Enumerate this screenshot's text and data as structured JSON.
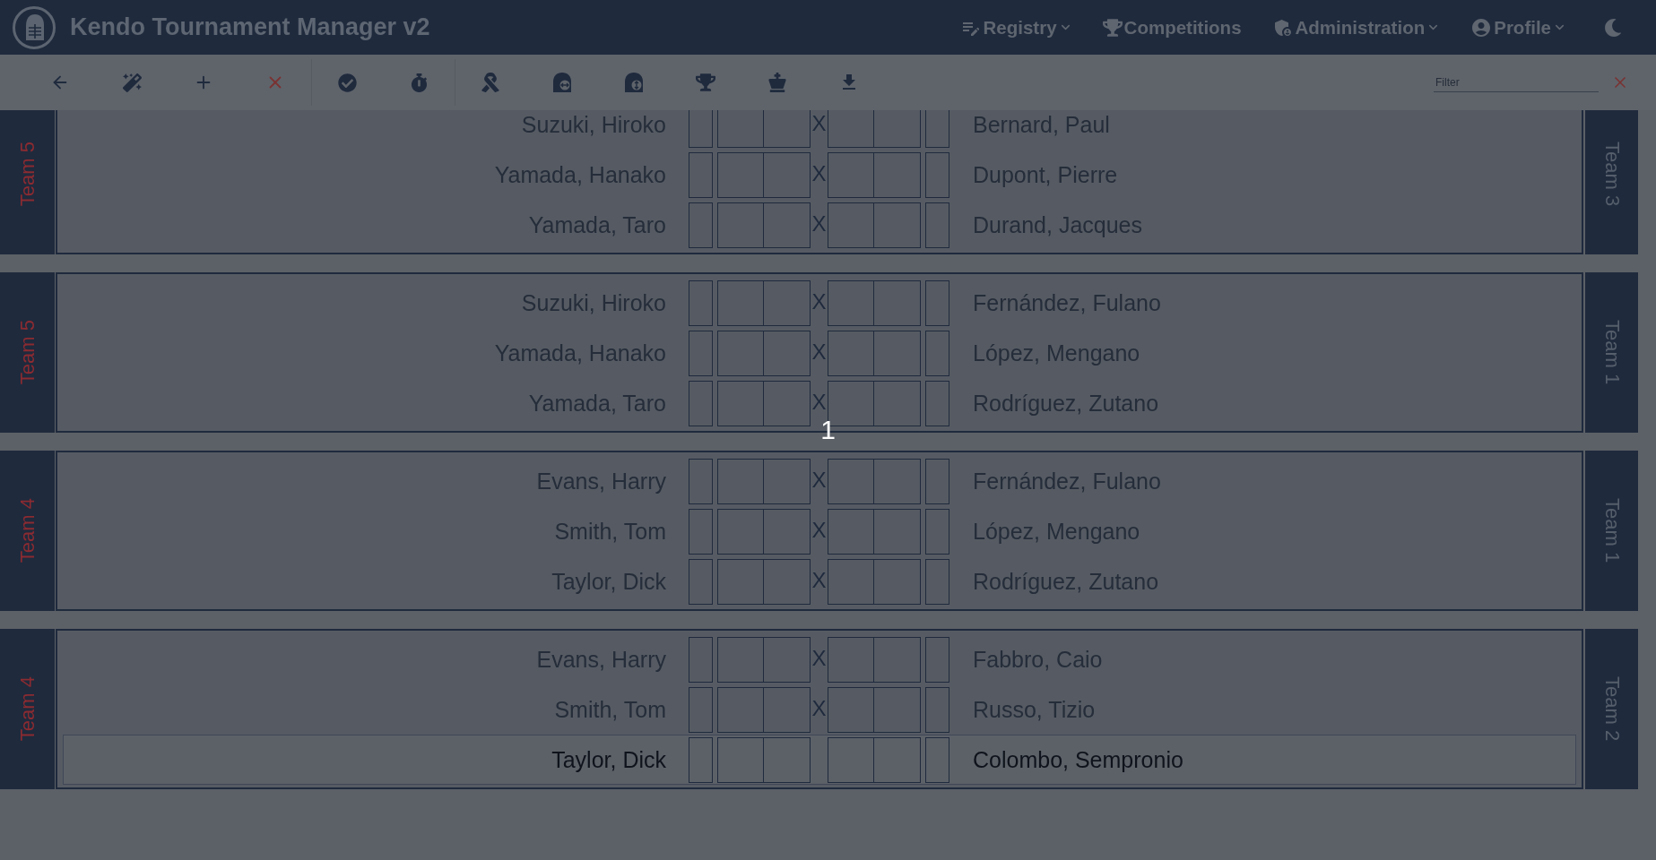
{
  "app": {
    "title": "Kendo Tournament Manager v2"
  },
  "nav": [
    {
      "label": "Registry",
      "kind": "dropdown"
    },
    {
      "label": "Competitions",
      "kind": "link"
    },
    {
      "label": "Administration",
      "kind": "dropdown"
    },
    {
      "label": "Profile",
      "kind": "dropdown"
    }
  ],
  "filter": {
    "placeholder": "Filter"
  },
  "groups": [
    {
      "left_team": "Team 5",
      "right_team": "Team 3",
      "fights": [
        {
          "left": "Suzuki, Hiroko",
          "right": "Bernard, Paul",
          "mark": "X",
          "selected": false
        },
        {
          "left": "Yamada, Hanako",
          "right": "Dupont, Pierre",
          "mark": "X",
          "selected": false
        },
        {
          "left": "Yamada, Taro",
          "right": "Durand, Jacques",
          "mark": "X",
          "selected": false
        }
      ]
    },
    {
      "left_team": "Team 5",
      "right_team": "Team 1",
      "fights": [
        {
          "left": "Suzuki, Hiroko",
          "right": "Fernández, Fulano",
          "mark": "X",
          "selected": false
        },
        {
          "left": "Yamada, Hanako",
          "right": "López, Mengano",
          "mark": "X",
          "selected": false
        },
        {
          "left": "Yamada, Taro",
          "right": "Rodríguez, Zutano",
          "mark": "X",
          "selected": false
        }
      ]
    },
    {
      "left_team": "Team 4",
      "right_team": "Team 1",
      "fights": [
        {
          "left": "Evans, Harry",
          "right": "Fernández, Fulano",
          "mark": "X",
          "selected": false
        },
        {
          "left": "Smith, Tom",
          "right": "López, Mengano",
          "mark": "X",
          "selected": false
        },
        {
          "left": "Taylor, Dick",
          "right": "Rodríguez, Zutano",
          "mark": "X",
          "selected": false
        }
      ]
    },
    {
      "left_team": "Team 4",
      "right_team": "Team 2",
      "fights": [
        {
          "left": "Evans, Harry",
          "right": "Fabbro, Caio",
          "mark": "X",
          "selected": false
        },
        {
          "left": "Smith, Tom",
          "right": "Russo, Tizio",
          "mark": "X",
          "selected": false
        },
        {
          "left": "Taylor, Dick",
          "right": "Colombo, Sempronio",
          "selected": true
        }
      ]
    }
  ],
  "countdown": "1"
}
